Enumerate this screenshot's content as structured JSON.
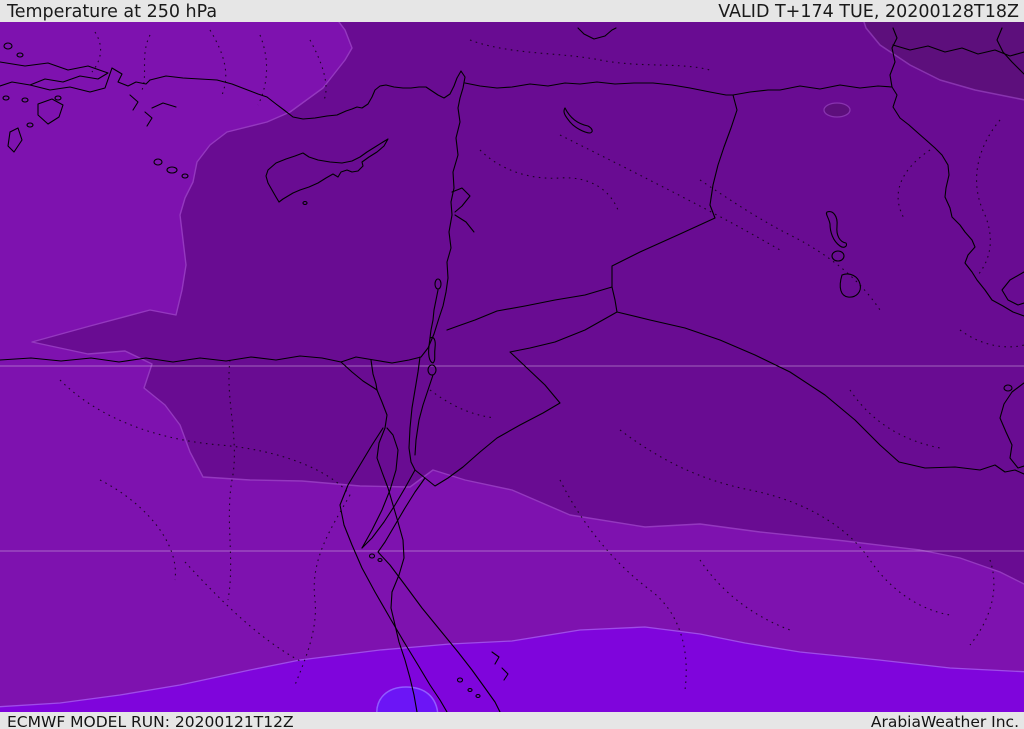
{
  "header": {
    "title": "Temperature at 250 hPa",
    "valid_label": "VALID T+174 TUE, 20200128T18Z"
  },
  "footer": {
    "model_run": "ECMWF MODEL RUN: 20200121T12Z",
    "attribution": "ArabiaWeather Inc."
  },
  "map": {
    "field": "Temperature",
    "level": "250 hPa",
    "model": "ECMWF",
    "palette": {
      "band_mid": "#7E12AF",
      "band_cold": "#690C92",
      "band_coldest": "#5D0F7C",
      "band_warm": "#7F05DC",
      "band_warmest": "#6C15F6",
      "rim_cold": "#9438BF",
      "rim_coldest": "#8833AF",
      "rim_warm": "#9F4BE8",
      "rim_warmest": "#915BFF",
      "coastline": "#000000",
      "admin_dots": "#0A000A",
      "graticule": "#D9BCE6",
      "chrome_bg": "#E6E6E6",
      "chrome_text": "#1A1A1A"
    }
  }
}
